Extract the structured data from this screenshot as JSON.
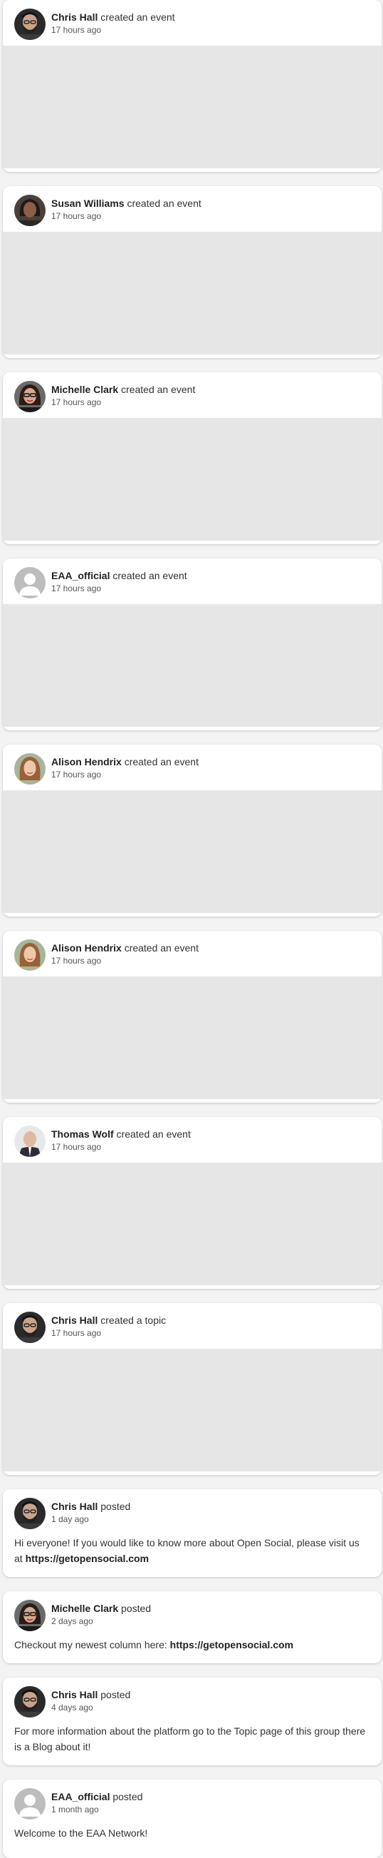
{
  "stream": {
    "events": [
      {
        "author": "Chris Hall",
        "action": "created an event",
        "time": "17 hours ago",
        "avatar": "chris-hall-avatar"
      },
      {
        "author": "Susan Williams",
        "action": "created an event",
        "time": "17 hours ago",
        "avatar": "susan-williams-avatar"
      },
      {
        "author": "Michelle Clark",
        "action": "created an event",
        "time": "17 hours ago",
        "avatar": "michelle-clark-avatar"
      },
      {
        "author": "EAA_official",
        "action": "created an event",
        "time": "17 hours ago",
        "avatar": "default-user-avatar"
      },
      {
        "author": "Alison Hendrix",
        "action": "created an event",
        "time": "17 hours ago",
        "avatar": "alison-hendrix-avatar"
      },
      {
        "author": "Alison Hendrix",
        "action": "created an event",
        "time": "17 hours ago",
        "avatar": "alison-hendrix-avatar"
      },
      {
        "author": "Thomas Wolf",
        "action": "created an event",
        "time": "17 hours ago",
        "avatar": "thomas-wolf-avatar"
      },
      {
        "author": "Chris Hall",
        "action": "created a topic",
        "time": "17 hours ago",
        "avatar": "chris-hall-avatar"
      }
    ],
    "posts": [
      {
        "author": "Chris Hall",
        "action": "posted",
        "time": "1 day ago",
        "avatar": "chris-hall-avatar",
        "text": "Hi everyone! If you would like to know more about Open Social, please visit us at ",
        "link": "https://getopensocial.com"
      },
      {
        "author": "Michelle Clark",
        "action": "posted",
        "time": "2 days ago",
        "avatar": "michelle-clark-avatar",
        "text": "Checkout my newest column here: ",
        "link": "https://getopensocial.com"
      },
      {
        "author": "Chris Hall",
        "action": "posted",
        "time": "4 days ago",
        "avatar": "chris-hall-avatar",
        "text": "For more information about the platform go to the Topic page of this group there is a Blog about it!",
        "link": ""
      },
      {
        "author": "EAA_official",
        "action": "posted",
        "time": "1 month ago",
        "avatar": "default-user-avatar",
        "text": "Welcome to the EAA Network!",
        "link": ""
      }
    ]
  },
  "colors": {
    "page_bg": "#f3f3f3",
    "card_bg": "#ffffff",
    "media_placeholder": "#e6e6e6"
  }
}
